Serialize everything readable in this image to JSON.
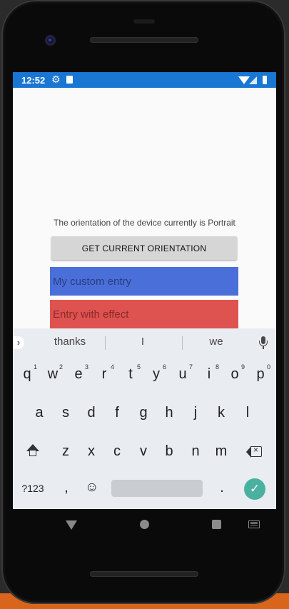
{
  "status_bar": {
    "time": "12:52",
    "left_icons": [
      "gear-icon",
      "sd-card-icon"
    ],
    "right_icons": [
      "wifi-icon",
      "signal-icon",
      "battery-icon"
    ]
  },
  "app": {
    "orientation_text": "The orientation of the device currently is Portrait",
    "button_label": "GET CURRENT ORIENTATION",
    "entries": [
      {
        "text": "My custom entry",
        "color": "#4a6fd9"
      },
      {
        "text": "Entry with effect",
        "color": "#de524f"
      }
    ]
  },
  "keyboard": {
    "suggestions": [
      "thanks",
      "I",
      "we"
    ],
    "row1": [
      "q",
      "w",
      "e",
      "r",
      "t",
      "y",
      "u",
      "i",
      "o",
      "p"
    ],
    "row1_hints": [
      "1",
      "2",
      "3",
      "4",
      "5",
      "6",
      "7",
      "8",
      "9",
      "0"
    ],
    "row2": [
      "a",
      "s",
      "d",
      "f",
      "g",
      "h",
      "j",
      "k",
      "l"
    ],
    "row3": [
      "z",
      "x",
      "c",
      "v",
      "b",
      "n",
      "m"
    ],
    "symbols_label": "?123",
    "comma": ",",
    "period": ".",
    "enter_color": "#4ab0a0"
  },
  "colors": {
    "status_bar": "#1976d2",
    "button": "#d6d6d6"
  }
}
